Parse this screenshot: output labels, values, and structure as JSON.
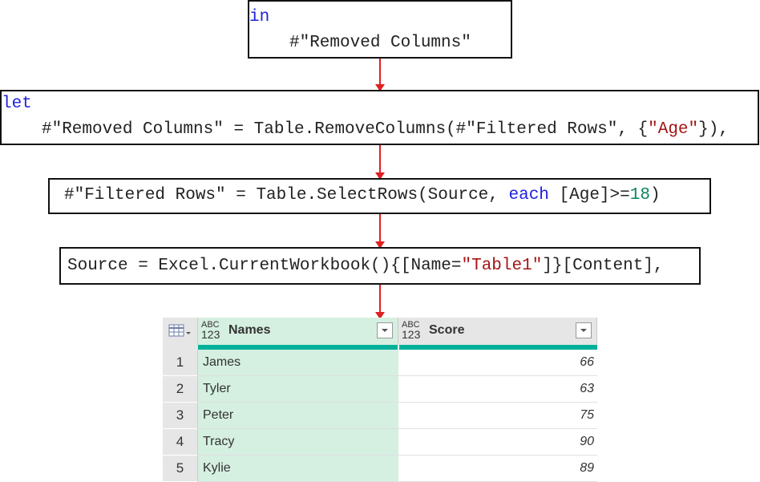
{
  "steps": {
    "in_box": {
      "keyword": "in",
      "line2": "#\"Removed Columns\""
    },
    "let_box": {
      "keyword": "let",
      "line2_a": "#\"Removed Columns\" = Table.RemoveColumns(#\"Filtered Rows\", {",
      "line2_str": "\"Age\"",
      "line2_b": "}),"
    },
    "filter_box": {
      "a": "#\"Filtered Rows\" = Table.SelectRows(Source, ",
      "kw": "each",
      "b": " [Age]>=",
      "num": "18",
      "c": ")"
    },
    "source_box": {
      "a": "Source = Excel.CurrentWorkbook(){[Name=",
      "str": "\"Table1\"",
      "b": "]}[Content],"
    }
  },
  "colors": {
    "arrow": "#e02020",
    "keyword": "#2020e0",
    "string": "#a31515",
    "number": "#098658",
    "selected_column": "#d5efe1",
    "teal_bar": "#00b09a"
  },
  "table": {
    "type_label_top": "ABC",
    "type_label_bottom": "123",
    "columns": [
      "Names",
      "Score"
    ],
    "rows": [
      {
        "index": "1",
        "name": "James",
        "score": "66"
      },
      {
        "index": "2",
        "name": "Tyler",
        "score": "63"
      },
      {
        "index": "3",
        "name": "Peter",
        "score": "75"
      },
      {
        "index": "4",
        "name": "Tracy",
        "score": "90"
      },
      {
        "index": "5",
        "name": "Kylie",
        "score": "89"
      }
    ]
  }
}
